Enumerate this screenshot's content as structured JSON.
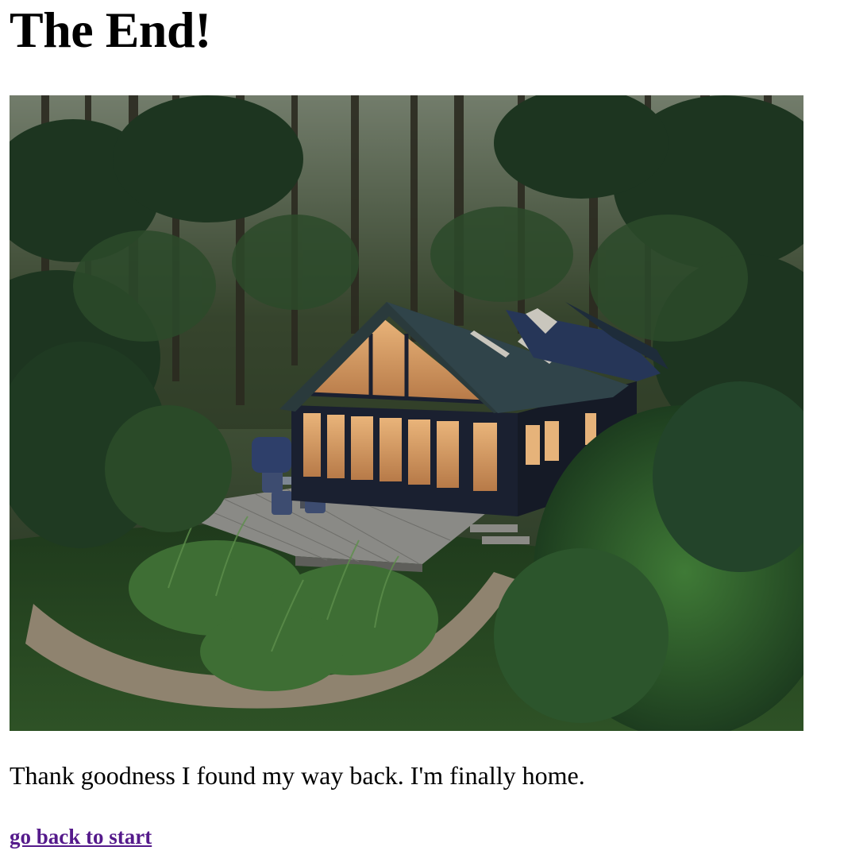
{
  "page": {
    "title": "The End!",
    "message": "Thank goodness I found my way back. I'm finally home.",
    "back_link": "go back to start",
    "link_color": "#551a8b"
  },
  "photo": {
    "subject": "cabin-in-forest-photo"
  }
}
